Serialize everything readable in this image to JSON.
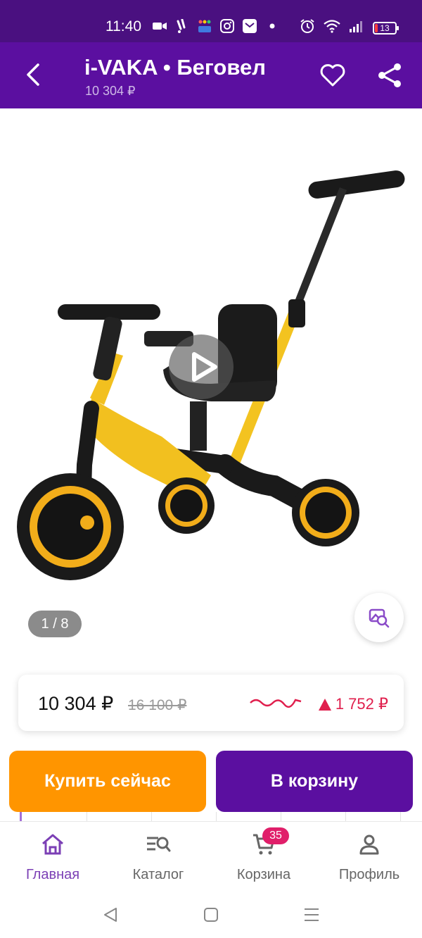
{
  "status_bar": {
    "time": "11:40",
    "battery": "13",
    "icons": [
      "camera-icon",
      "notification-icon",
      "detmir-icon",
      "instagram-icon",
      "mail-icon",
      "dot-icon",
      "alarm-icon",
      "wifi-icon",
      "signal-icon",
      "battery-icon"
    ]
  },
  "header": {
    "title": "i-VAKA • Беговел",
    "subtitle": "10 304 ₽"
  },
  "gallery": {
    "counter": "1 / 8"
  },
  "price": {
    "current": "10 304 ₽",
    "old": "16 100 ₽",
    "diff": "1 752 ₽"
  },
  "actions": {
    "buy_now": "Купить сейчас",
    "add_to_cart": "В корзину"
  },
  "bottom_nav": {
    "items": [
      {
        "label": "Главная",
        "icon": "home-icon",
        "active": true
      },
      {
        "label": "Каталог",
        "icon": "catalog-search-icon",
        "active": false
      },
      {
        "label": "Корзина",
        "icon": "cart-icon",
        "active": false,
        "badge": "35"
      },
      {
        "label": "Профиль",
        "icon": "profile-icon",
        "active": false
      }
    ]
  },
  "colors": {
    "header_bg": "#5b0fa0",
    "status_bg": "#4a1080",
    "buy_now_bg": "#ff9500",
    "cart_bg": "#5b0fa0",
    "price_up": "#e01f4d",
    "nav_active": "#7b3fb5",
    "badge": "#e01f6a"
  }
}
